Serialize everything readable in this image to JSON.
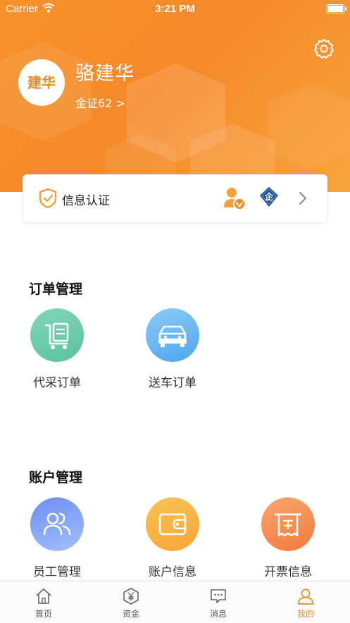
{
  "status": {
    "carrier": "Carrier",
    "time": "3:21 PM"
  },
  "profile": {
    "avatar_text": "建华",
    "name": "骆建华",
    "subtitle": "金证62 >"
  },
  "auth": {
    "label": "信息认证",
    "person_icon": "person-verified-icon",
    "enterprise_badge": "企"
  },
  "sections": {
    "orders": {
      "title": "订单管理",
      "items": [
        {
          "label": "代采订单",
          "icon": "procurement-cart-icon",
          "color": "#6fcfae"
        },
        {
          "label": "送车订单",
          "icon": "car-icon",
          "color": "#63b4f5"
        }
      ]
    },
    "account": {
      "title": "账户管理",
      "items": [
        {
          "label": "员工管理",
          "icon": "staff-icon",
          "color": "#6d8ff2"
        },
        {
          "label": "账户信息",
          "icon": "wallet-icon",
          "color": "#f7b84a"
        },
        {
          "label": "开票信息",
          "icon": "invoice-icon",
          "color": "#f7864a"
        }
      ]
    }
  },
  "tabbar": [
    {
      "label": "首页",
      "icon": "home-icon"
    },
    {
      "label": "资金",
      "icon": "funds-icon"
    },
    {
      "label": "消息",
      "icon": "message-icon"
    },
    {
      "label": "我的",
      "icon": "profile-icon",
      "active": true
    }
  ],
  "colors": {
    "brand_orange": "#f28a22",
    "header_gradient_start": "#f7922a",
    "header_gradient_end": "#f8a33c"
  }
}
